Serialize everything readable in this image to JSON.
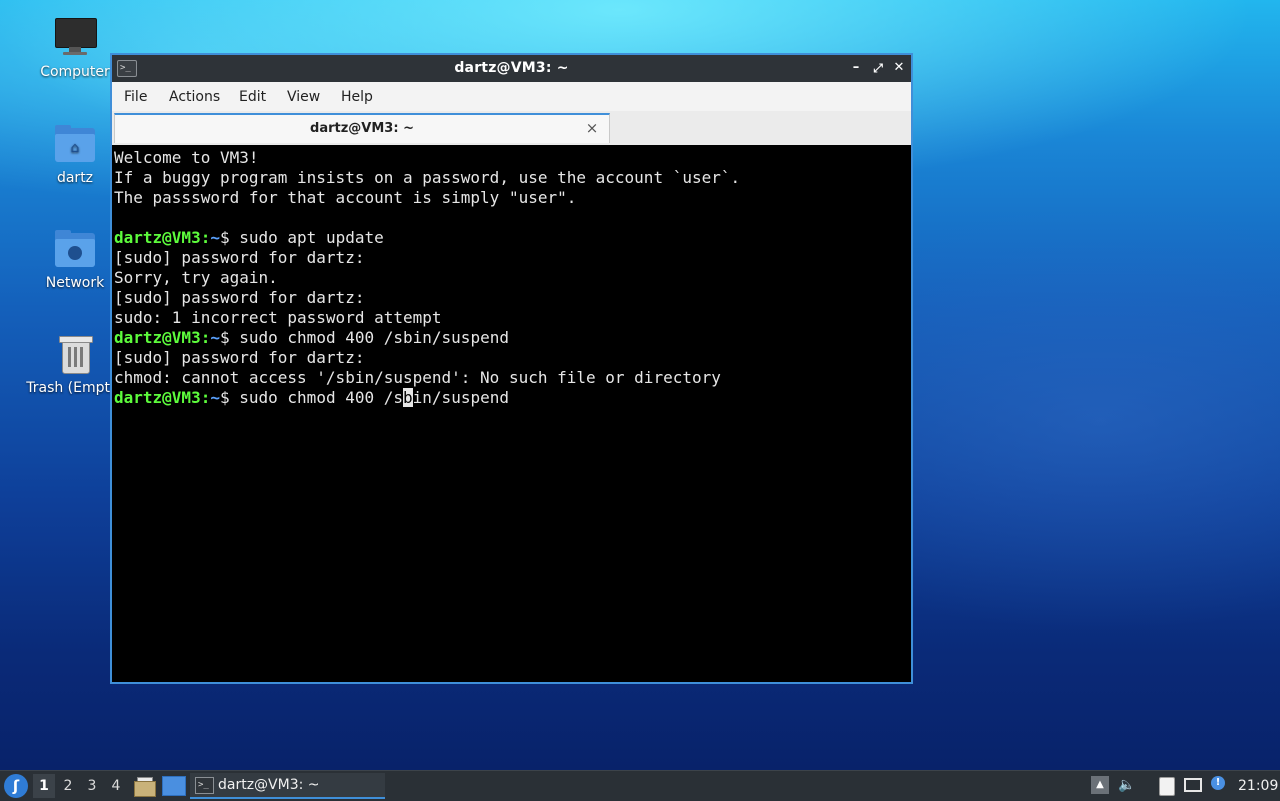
{
  "desktop": {
    "icons": [
      {
        "label": "Computer",
        "icon": "computer-icon"
      },
      {
        "label": "dartz",
        "icon": "home-folder-icon"
      },
      {
        "label": "Network",
        "icon": "network-folder-icon"
      },
      {
        "label": "Trash (Empty)",
        "icon": "trash-icon"
      }
    ]
  },
  "window": {
    "title": "dartz@VM3: ~",
    "icon": "terminal-icon",
    "controls": {
      "minimize": "–",
      "maximize": "⤢",
      "close": "✕"
    },
    "menu": [
      "File",
      "Actions",
      "Edit",
      "View",
      "Help"
    ],
    "tab": {
      "label": "dartz@VM3: ~",
      "close": "×"
    }
  },
  "terminal": {
    "lines": [
      {
        "type": "text",
        "text": "Welcome to VM3!"
      },
      {
        "type": "text",
        "text": "If a buggy program insists on a password, use the account `user`."
      },
      {
        "type": "text",
        "text": "The passsword for that account is simply \"user\"."
      },
      {
        "type": "text",
        "text": ""
      },
      {
        "type": "prompt",
        "user": "dartz@VM3",
        "sep": ":",
        "path": "~",
        "cmd": "$ sudo apt update"
      },
      {
        "type": "text",
        "text": "[sudo] password for dartz:"
      },
      {
        "type": "text",
        "text": "Sorry, try again."
      },
      {
        "type": "text",
        "text": "[sudo] password for dartz:"
      },
      {
        "type": "text",
        "text": "sudo: 1 incorrect password attempt"
      },
      {
        "type": "prompt",
        "user": "dartz@VM3",
        "sep": ":",
        "path": "~",
        "cmd": "$ sudo chmod 400 /sbin/suspend"
      },
      {
        "type": "text",
        "text": "[sudo] password for dartz:"
      },
      {
        "type": "text",
        "text": "chmod: cannot access '/sbin/suspend': No such file or directory"
      },
      {
        "type": "prompt",
        "user": "dartz@VM3",
        "sep": ":",
        "path": "~",
        "cmd_before": "$ sudo chmod 400 /s",
        "cmd_cursor": "b",
        "cmd_after": "in/suspend"
      }
    ]
  },
  "taskbar": {
    "start_icon": "lxqt-start-icon",
    "workspaces": [
      "1",
      "2",
      "3",
      "4"
    ],
    "active_workspace": "1",
    "quicklaunch": [
      "file-manager-icon",
      "show-desktop-icon"
    ],
    "task": {
      "label": "dartz@VM3: ~",
      "icon": "terminal-icon"
    },
    "tray": [
      "tray-expand-icon",
      "volume-icon",
      "clipboard-icon",
      "network-icon",
      "info-icon"
    ],
    "clock": "21:09"
  },
  "colors": {
    "accent": "#3f8fd9",
    "prompt_user": "#5dfc3c",
    "prompt_path": "#5aa2ff",
    "terminal_bg": "#000000"
  }
}
